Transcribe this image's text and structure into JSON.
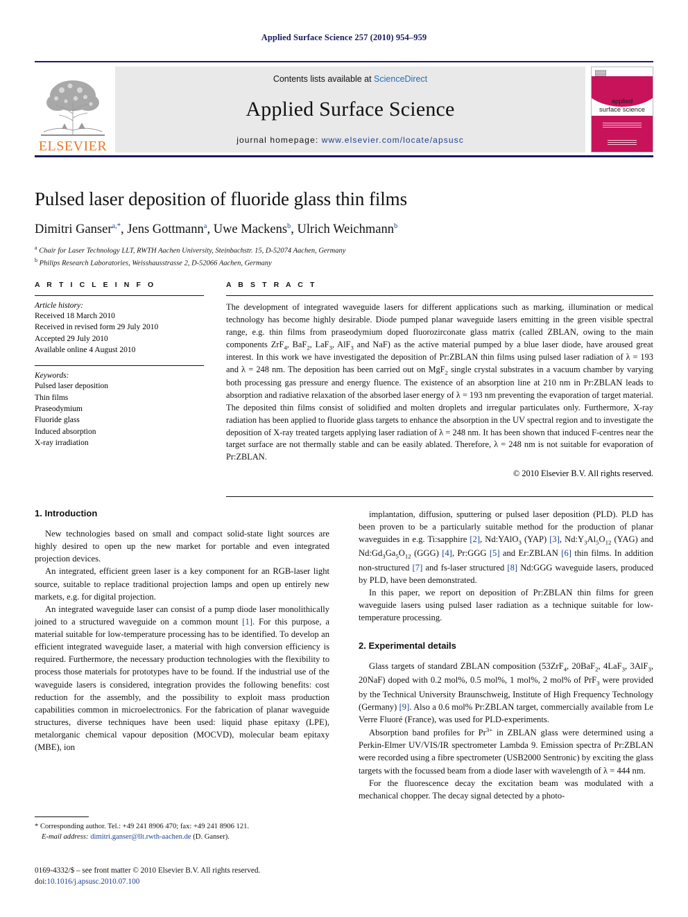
{
  "running_head": "Applied Surface Science 257 (2010) 954–959",
  "masthead": {
    "contents_prefix": "Contents lists available at ",
    "sciencedirect": "ScienceDirect",
    "journal_name": "Applied Surface Science",
    "homepage_prefix": "journal homepage:",
    "homepage_url": "www.elsevier.com/locate/apsusc",
    "publisher_wordmark": "ELSEVIER",
    "cover_title_line1": "applied",
    "cover_title_line2": "surface science",
    "accent_color": "#C8135B",
    "brand_color": "#E87722",
    "link_color": "#1a3f8f"
  },
  "title": "Pulsed laser deposition of fluoride glass thin films",
  "authors": [
    {
      "name": "Dimitri Ganser",
      "marks": "a,*"
    },
    {
      "name": "Jens Gottmann",
      "marks": "a"
    },
    {
      "name": "Uwe Mackens",
      "marks": "b"
    },
    {
      "name": "Ulrich Weichmann",
      "marks": "b"
    }
  ],
  "affiliations": [
    {
      "mark": "a",
      "text": "Chair for Laser Technology LLT, RWTH Aachen University, Steinbachstr. 15, D-52074 Aachen, Germany"
    },
    {
      "mark": "b",
      "text": "Philips Research Laboratories, Weisshausstrasse 2, D-52066 Aachen, Germany"
    }
  ],
  "article_info": {
    "heading": "A R T I C L E  I N F O",
    "history_label": "Article history:",
    "history": [
      "Received 18 March 2010",
      "Received in revised form 29 July 2010",
      "Accepted 29 July 2010",
      "Available online 4 August 2010"
    ],
    "keywords_label": "Keywords:",
    "keywords": [
      "Pulsed laser deposition",
      "Thin films",
      "Praseodymium",
      "Fluoride glass",
      "Induced absorption",
      "X-ray irradiation"
    ]
  },
  "abstract": {
    "heading": "A B S T R A C T",
    "text_html": "The development of integrated waveguide lasers for different applications such as marking, illumination or medical technology has become highly desirable. Diode pumped planar waveguide lasers emitting in the green visible spectral range, e.g. thin films from praseodymium doped fluorozirconate glass matrix (called ZBLAN, owing to the main components ZrF<sub>4</sub>, BaF<sub>2</sub>, LaF<sub>3</sub>, AlF<sub>3</sub> and NaF) as the active material pumped by a blue laser diode, have aroused great interest. In this work we have investigated the deposition of Pr:ZBLAN thin films using pulsed laser radiation of λ = 193 and λ = 248 nm. The deposition has been carried out on MgF<sub>2</sub> single crystal substrates in a vacuum chamber by varying both processing gas pressure and energy fluence. The existence of an absorption line at 210 nm in Pr:ZBLAN leads to absorption and radiative relaxation of the absorbed laser energy of λ = 193 nm preventing the evaporation of target material. The deposited thin films consist of solidified and molten droplets and irregular particulates only. Furthermore, X-ray radiation has been applied to fluoride glass targets to enhance the absorption in the UV spectral region and to investigate the deposition of X-ray treated targets applying laser radiation of λ = 248 nm. It has been shown that induced F-centres near the target surface are not thermally stable and can be easily ablated. Therefore, λ = 248 nm is not suitable for evaporation of Pr:ZBLAN.",
    "copyright": "© 2010 Elsevier B.V. All rights reserved."
  },
  "sections": {
    "introduction_heading": "1.  Introduction",
    "experimental_heading": "2.  Experimental details"
  },
  "left_column": {
    "p1_html": "New technologies based on small and compact solid-state light sources are highly desired to open up the new market for portable and even integrated projection devices.",
    "p2_html": "An integrated, efficient green laser is a key component for an RGB-laser light source, suitable to replace traditional projection lamps and open up entirely new markets, e.g. for digital projection.",
    "p3_html": "An integrated waveguide laser can consist of a pump diode laser monolithically joined to a structured waveguide on a common mount <span class=\"ref\">[1]</span>. For this purpose, a material suitable for low-temperature processing has to be identified. To develop an efficient integrated waveguide laser, a material with high conversion efficiency is required. Furthermore, the necessary production technologies with the flexibility to process those materials for prototypes have to be found. If the industrial use of the waveguide lasers is considered, integration provides the following benefits: cost reduction for the assembly, and the possibility to exploit mass production capabilities common in microelectronics. For the fabrication of planar waveguide structures, diverse techniques have been used: liquid phase epitaxy (LPE), metalorganic chemical vapour deposition (MOCVD), molecular beam epitaxy (MBE), ion"
  },
  "right_column": {
    "p1_html": "implantation, diffusion, sputtering or pulsed laser deposition (PLD). PLD has been proven to be a particularly suitable method for the production of planar waveguides in e.g. Ti:sapphire <span class=\"ref\">[2]</span>, Nd:YAlO<sub>3</sub> (YAP) <span class=\"ref\">[3]</span>, Nd:Y<sub>3</sub>Al<sub>5</sub>O<sub>12</sub> (YAG) and Nd:Gd<sub>3</sub>Ga<sub>5</sub>O<sub>12</sub> (GGG) <span class=\"ref\">[4]</span>, Pr:GGG <span class=\"ref\">[5]</span> and Er:ZBLAN <span class=\"ref\">[6]</span> thin films. In addition non-structured <span class=\"ref\">[7]</span> and fs-laser structured <span class=\"ref\">[8]</span> Nd:GGG waveguide lasers, produced by PLD, have been demonstrated.",
    "p2_html": "In this paper, we report on deposition of Pr:ZBLAN thin films for green waveguide lasers using pulsed laser radiation as a technique suitable for low-temperature processing.",
    "p3_html": "Glass targets of standard ZBLAN composition (53ZrF<sub>4</sub>, 20BaF<sub>2</sub>, 4LaF<sub>3</sub>, 3AlF<sub>3</sub>, 20NaF) doped with 0.2 mol%, 0.5 mol%, 1 mol%, 2 mol% of PrF<sub>3</sub> were provided by the Technical University Braunschweig, Institute of High Frequency Technology (Germany) <span class=\"ref\">[9]</span>. Also a 0.6 mol% Pr:ZBLAN target, commercially available from Le Verre Fluoré (France), was used for PLD-experiments.",
    "p4_html": "Absorption band profiles for Pr<sup>3+</sup> in ZBLAN glass were determined using a Perkin-Elmer UV/VIS/IR spectrometer Lambda 9. Emission spectra of Pr:ZBLAN were recorded using a fibre spectrometer (USB2000 Sentronic) by exciting the glass targets with the focussed beam from a diode laser with wavelength of λ = 444 nm.",
    "p5_html": "For the fluorescence decay the excitation beam was modulated with a mechanical chopper. The decay signal detected by a photo-"
  },
  "footnote": {
    "corresponding_html": "* Corresponding author. Tel.: +49 241 8906 470; fax: +49 241 8906 121.",
    "email_label": "E-mail address:",
    "email": "dimitri.ganser@llt.rwth-aachen.de",
    "email_suffix": "(D. Ganser)."
  },
  "footer": {
    "issn_line_html": "0169-4332/$ – see front matter © 2010 Elsevier B.V. All rights reserved.",
    "doi_prefix": "doi:",
    "doi": "10.1016/j.apsusc.2010.07.100"
  }
}
